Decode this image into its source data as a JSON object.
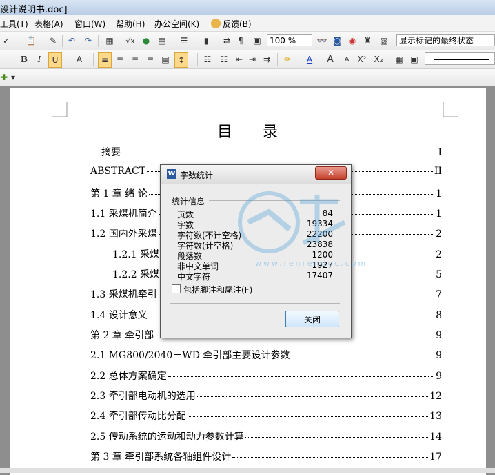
{
  "window": {
    "title": "设计说明书.doc]"
  },
  "menu": [
    "工具(T)",
    "表格(A)",
    "窗口(W)",
    "帮助(H)",
    "办公空间(K)",
    "反馈(B)"
  ],
  "toolbar1": {
    "zoom": "100 %",
    "view_mode": "显示标记的最终状态"
  },
  "toc": {
    "title": "目　　录",
    "entries": [
      {
        "text": "摘要",
        "page": "I"
      },
      {
        "text": "ABSTRACT",
        "page": "II"
      },
      {
        "text": "第 1 章  绪  论",
        "page": "1"
      },
      {
        "text": "1.1  采煤机简介",
        "page": "1"
      },
      {
        "text": "1.2  国内外采煤",
        "page": "2"
      },
      {
        "text": "1.2.1  采煤",
        "page": "2"
      },
      {
        "text": "1.2.2  采煤",
        "page": "5"
      },
      {
        "text": "1.3  采煤机牵引",
        "page": "7"
      },
      {
        "text": "1.4  设计意义",
        "page": "8"
      },
      {
        "text": "第 2 章  牵引部",
        "page": "9"
      },
      {
        "text": "2.1 MG800/2040－WD 牵引部主要设计参数",
        "page": "9"
      },
      {
        "text": "2.2  总体方案确定",
        "page": "9"
      },
      {
        "text": "2.3  牵引部电动机的选用",
        "page": "12"
      },
      {
        "text": "2.4  牵引部传动比分配",
        "page": "13"
      },
      {
        "text": "2.5 传动系统的运动和动力参数计算",
        "page": "14"
      },
      {
        "text": "第 3 章  牵引部系统各轴组件设计",
        "page": "17"
      }
    ]
  },
  "dialog": {
    "title": "字数统计",
    "group_label": "统计信息",
    "stats": [
      {
        "label": "页数",
        "value": "84"
      },
      {
        "label": "字数",
        "value": "19334"
      },
      {
        "label": "字符数(不计空格)",
        "value": "22200"
      },
      {
        "label": "字符数(计空格)",
        "value": "23838"
      },
      {
        "label": "段落数",
        "value": "1200"
      },
      {
        "label": "非中文单词",
        "value": "1927"
      },
      {
        "label": "中文字符",
        "value": "17407"
      }
    ],
    "checkbox_label": "包括脚注和尾注(F)",
    "close_button": "关闭"
  },
  "watermark": {
    "text": "www.renrendoc.com"
  }
}
